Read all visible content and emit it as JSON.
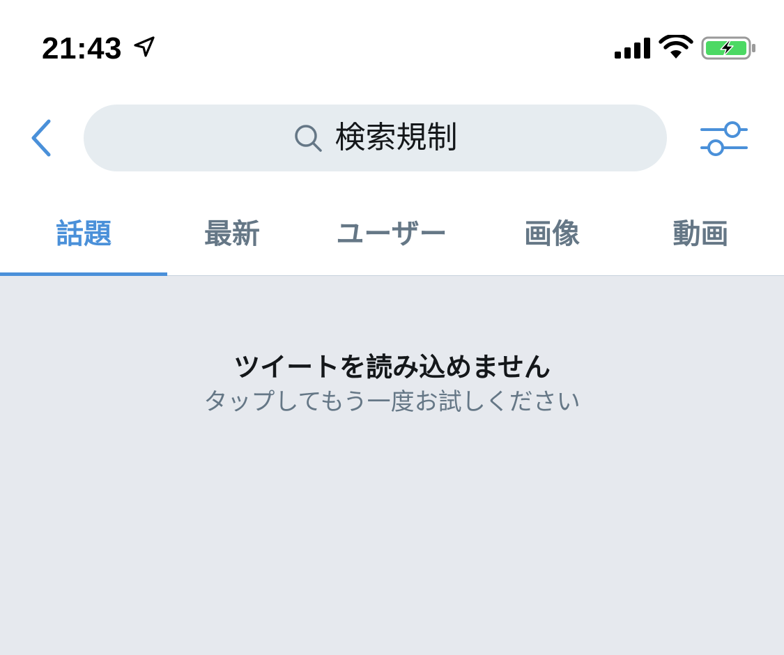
{
  "status_bar": {
    "time": "21:43",
    "icons": [
      "location-arrow-icon",
      "signal-bars-icon",
      "wifi-icon",
      "battery-charging-icon"
    ],
    "battery_color": "#4cd964"
  },
  "header": {
    "back_icon": "chevron-left-icon",
    "search_query": "検索規制",
    "search_icon": "magnifier-icon",
    "filter_icon": "sliders-icon"
  },
  "tabs": [
    {
      "label": "話題",
      "active": true
    },
    {
      "label": "最新",
      "active": false
    },
    {
      "label": "ユーザー",
      "active": false
    },
    {
      "label": "画像",
      "active": false
    },
    {
      "label": "動画",
      "active": false
    }
  ],
  "content": {
    "error_title": "ツイートを読み込めません",
    "error_subtitle": "タップしてもう一度お試しください"
  },
  "colors": {
    "accent": "#4a90d9",
    "tab_inactive": "#657786",
    "content_bg": "#e6e9ee",
    "search_bg": "#e6ecf0"
  }
}
